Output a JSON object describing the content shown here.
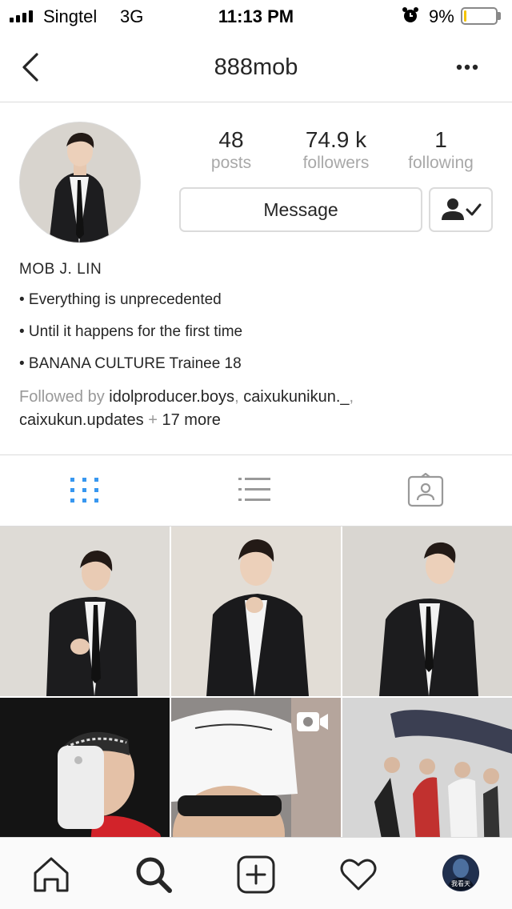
{
  "status_bar": {
    "carrier": "Singtel",
    "network": "3G",
    "time": "11:13 PM",
    "battery_percent": "9%",
    "battery_level": 0.09,
    "battery_color": "#f5c400"
  },
  "header": {
    "title": "888mob",
    "back_icon": "chevron-left-icon",
    "more_icon": "more-horizontal-icon"
  },
  "profile": {
    "stats": [
      {
        "value": "48",
        "label": "posts"
      },
      {
        "value": "74.9 k",
        "label": "followers"
      },
      {
        "value": "1",
        "label": "following"
      }
    ],
    "message_label": "Message",
    "following_icon": "person-check-icon",
    "display_name": "MOB J. LIN",
    "bio_lines": [
      "• Everything is unprecedented",
      "• Until it happens for the first time",
      "• BANANA CULTURE Trainee 18"
    ],
    "followed_by": {
      "prefix": "Followed by",
      "users": [
        "idolproducer.boys",
        "caixukunikun._",
        "caixukun.updates"
      ],
      "plus": "+",
      "more": "17 more"
    }
  },
  "tabs": [
    {
      "name": "grid-view-icon",
      "active": true
    },
    {
      "name": "list-view-icon",
      "active": false
    },
    {
      "name": "tagged-photos-icon",
      "active": false
    }
  ],
  "grid_posts": [
    {
      "kind": "photo"
    },
    {
      "kind": "photo"
    },
    {
      "kind": "photo"
    },
    {
      "kind": "photo"
    },
    {
      "kind": "video",
      "overlay_icon": "video-camera-icon"
    },
    {
      "kind": "photo"
    }
  ],
  "bottom_nav": [
    {
      "name": "home-icon"
    },
    {
      "name": "search-icon"
    },
    {
      "name": "new-post-icon"
    },
    {
      "name": "activity-heart-icon"
    },
    {
      "name": "profile-avatar"
    }
  ],
  "bottom_avatar_caption": "我看天",
  "colors": {
    "accent_blue": "#3897f0",
    "border": "#dbdbdb",
    "muted_text": "#a8a8a8"
  }
}
